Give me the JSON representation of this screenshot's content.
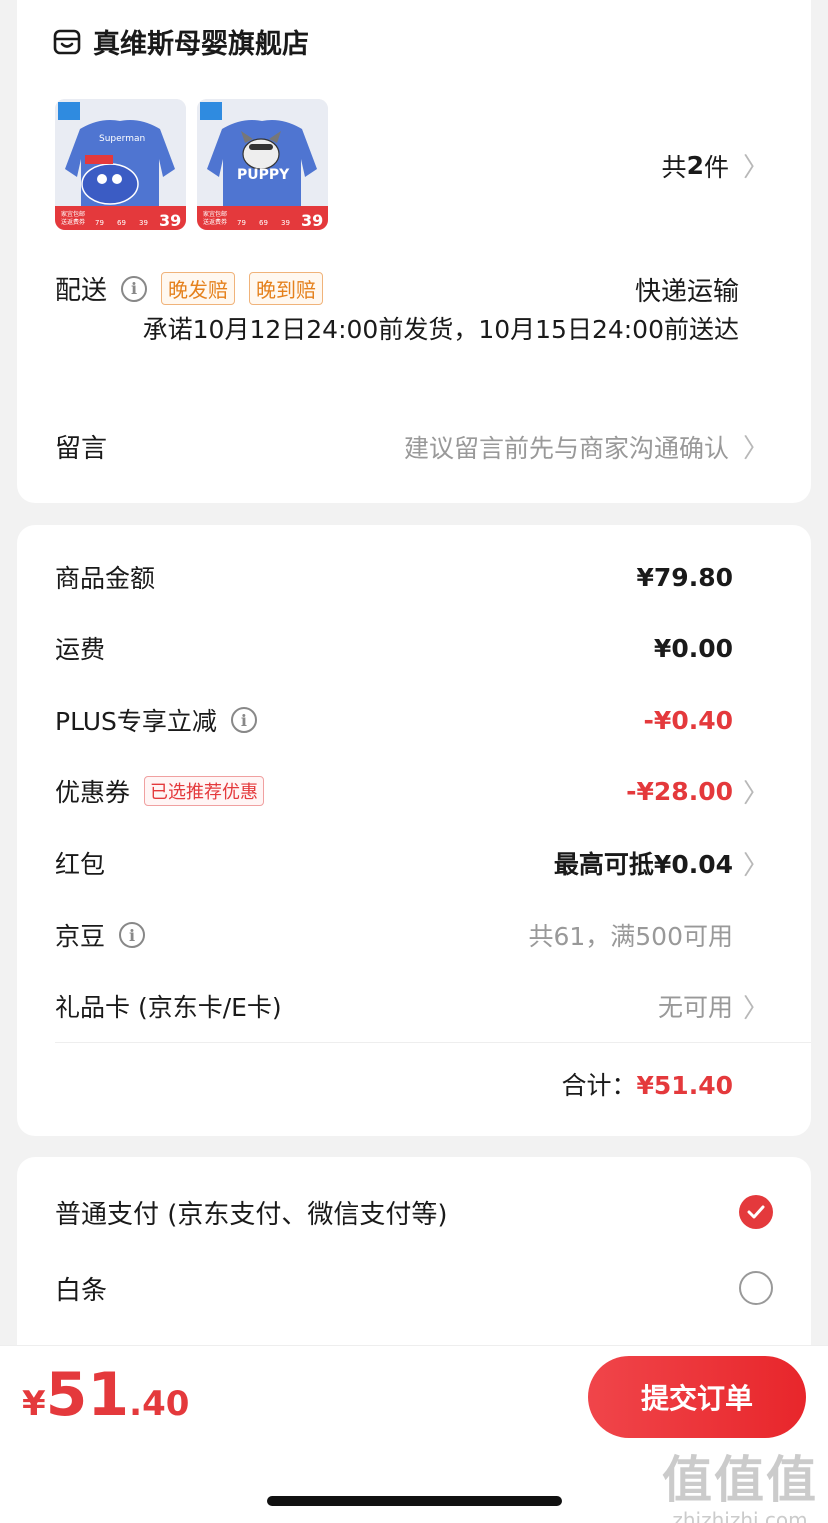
{
  "shop": {
    "name": "真维斯母婴旗舰店",
    "icon": "shop-icon"
  },
  "products": [
    {
      "print": "Superman",
      "badge_top": "家宜包邮",
      "badge_sub": "送返费券",
      "prices": [
        "79",
        "69",
        "39"
      ],
      "price": "39"
    },
    {
      "print": "PUPPY",
      "badge_top": "家宜包邮",
      "badge_sub": "送返费券",
      "prices": [
        "79",
        "69",
        "39"
      ],
      "price": "39"
    }
  ],
  "items_count": {
    "prefix": "共",
    "num": "2",
    "suffix": "件"
  },
  "delivery": {
    "label": "配送",
    "tags": [
      "晚发赔",
      "晚到赔"
    ],
    "type": "快递运输",
    "promise": "承诺10月12日24:00前发货，10月15日24:00前送达"
  },
  "message": {
    "label": "留言",
    "placeholder": "建议留言前先与商家沟通确认"
  },
  "price_rows": {
    "goods": {
      "label": "商品金额",
      "value": "¥79.80"
    },
    "shipping": {
      "label": "运费",
      "value": "¥0.00"
    },
    "plus": {
      "label": "PLUS专享立减",
      "value": "-¥0.40"
    },
    "coupon": {
      "label": "优惠券",
      "tag": "已选推荐优惠",
      "value": "-¥28.00"
    },
    "redpacket": {
      "label": "红包",
      "value": "最高可抵¥0.04"
    },
    "beans": {
      "label": "京豆",
      "value": "共61，满500可用"
    },
    "giftcard": {
      "label": "礼品卡 (京东卡/E卡)",
      "value": "无可用"
    }
  },
  "total": {
    "label": "合计：",
    "value": "¥51.40"
  },
  "payment": {
    "normal": {
      "label": "普通支付 (京东支付、微信支付等)",
      "selected": true
    },
    "baitiao": {
      "label": "白条",
      "selected": false
    }
  },
  "bottom": {
    "currency": "¥",
    "int": "51",
    "dec": ".40",
    "submit": "提交订单"
  },
  "watermark": {
    "big": "值值值",
    "small": "zhizhizhi.com"
  },
  "colors": {
    "accent": "#e4393c",
    "orange_tag": "#e5811d",
    "sweater": "#4f75d1"
  }
}
